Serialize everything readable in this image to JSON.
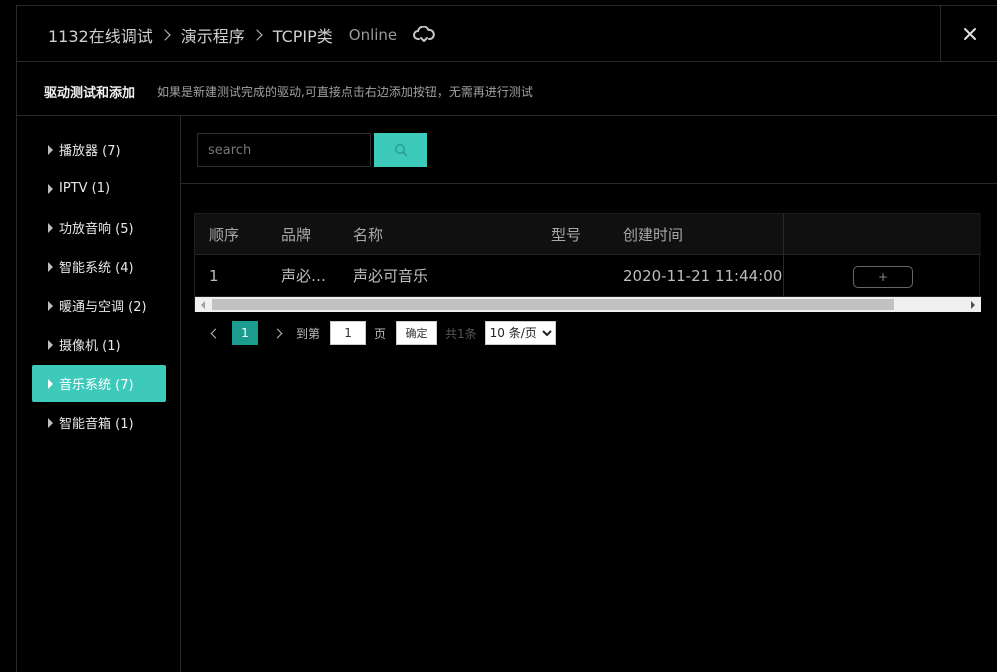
{
  "header": {
    "breadcrumbs": [
      "1132在线调试",
      "演示程序",
      "TCPIP类"
    ],
    "status": "Online"
  },
  "subheader": {
    "title": "驱动测试和添加",
    "description": "如果是新建测试完成的驱动,可直接点击右边添加按钮，无需再进行测试"
  },
  "sidebar": {
    "items": [
      {
        "label": "播放器 (7)"
      },
      {
        "label": "IPTV (1)"
      },
      {
        "label": "功放音响 (5)"
      },
      {
        "label": "智能系统 (4)"
      },
      {
        "label": "暖通与空调 (2)"
      },
      {
        "label": "摄像机 (1)"
      },
      {
        "label": "音乐系统 (7)"
      },
      {
        "label": "智能音箱 (1)"
      }
    ],
    "active_index": 6
  },
  "search": {
    "placeholder": "search",
    "value": ""
  },
  "table": {
    "columns": [
      "顺序",
      "品牌",
      "名称",
      "型号",
      "创建时间"
    ],
    "rows": [
      {
        "order": "1",
        "brand": "声必…",
        "name": "声必可音乐",
        "model": "",
        "created": "2020-11-21 11:44:00",
        "action": "+"
      }
    ]
  },
  "pagination": {
    "current_page": "1",
    "goto_label": "到第",
    "goto_value": "1",
    "page_unit": "页",
    "confirm_label": "确定",
    "total_text": "共1条",
    "page_size_options": [
      "10 条/页"
    ],
    "page_size_selected": "10 条/页"
  },
  "colors": {
    "accent": "#3dcabb",
    "page_active": "#1b9c8e",
    "background": "#000000"
  }
}
